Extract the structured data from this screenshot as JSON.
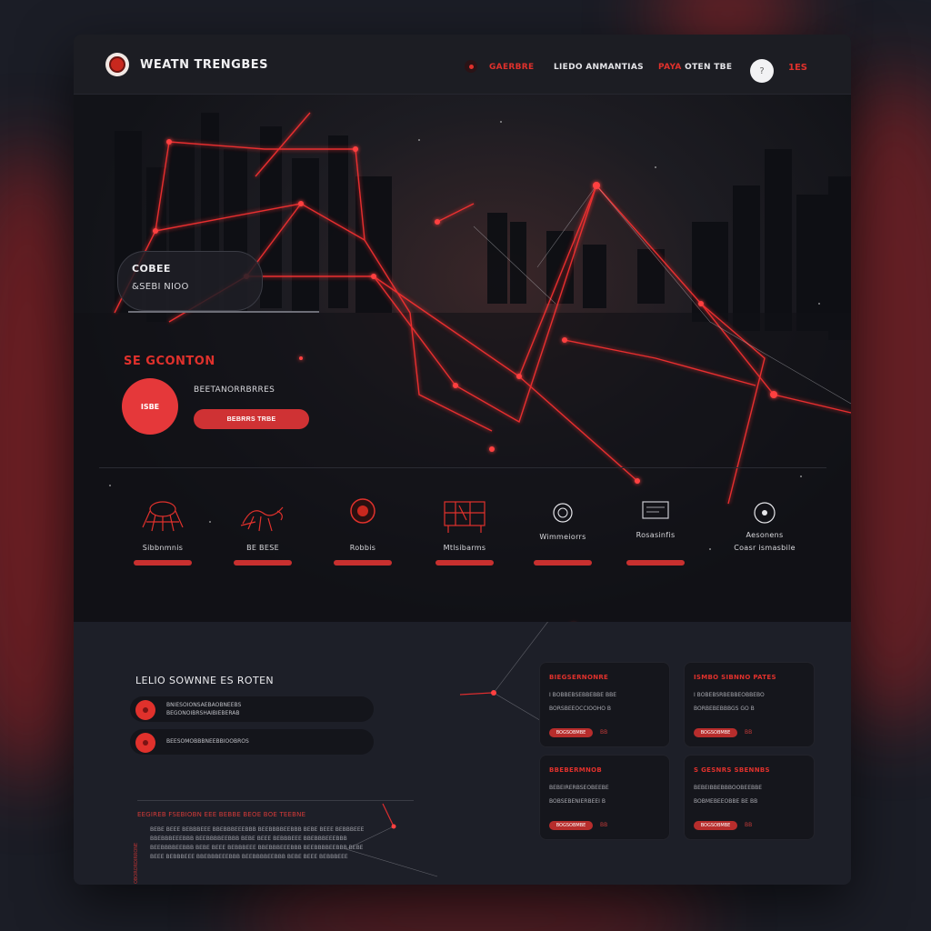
{
  "brand": {
    "name": "WEATN TRENGBES"
  },
  "nav": {
    "link1": "GAERBRE",
    "link2": "LIEDO ANMANTIAS",
    "link3_highlight": "PAYA",
    "link3_rest": "OTEN TBE",
    "count": "1ES"
  },
  "hero": {
    "pill_label": "COBEE",
    "pill_sub": "&SEBI NIOO",
    "section_title": "SE GCONTON",
    "circle_label": "ISBE",
    "caption": "BEETANORRBRRES",
    "button_label": "BEBRRS TRBE"
  },
  "features": [
    {
      "label": "Sibbnmnis"
    },
    {
      "label": "BE BESE"
    },
    {
      "label": "Robbis"
    },
    {
      "label": "Mtlsibarms"
    },
    {
      "label": "Wimmeiorrs"
    },
    {
      "label": "Rosasinfis"
    },
    {
      "label_top": "Aesonens",
      "label": "Coasr ismasbile"
    }
  ],
  "bottom": {
    "list_title": "LELIO SOWNNE ES ROTEN",
    "rows": [
      {
        "line1": "BNIESOIONSAEBAOBNEEBS",
        "line2": "BEGONOIBRSHAIBIEBERAB"
      },
      {
        "line1": "BEESOMOBBBNEEBBIOOBROS",
        "line2": ""
      }
    ],
    "para_head": "EEGIREB FSEBIOBN EEE BEBBE BEOE BOE TEEBNE",
    "para_vert": "OBORORDIRRONE",
    "para": "BEBE BEEE BEBBBEEE BBEBBBEEEBBB BEEBBBBEEBBB BEBE BEEE BEBBBEEE BBEBBBEEEBBB BEEBBBBEEBBB BEBE BEEE BEBBBEEE BBEBBBEEEBBB BEEBBBBEEBBB BEBE BEEE BEBBBEEE BBEBBBEEEBBB BEEBBBBEEBBB BEBE BEEE BEBBBEEE BBEBBBEEEBBB BEEBBBBEEBBB BEBE BEEE BEBBBEEE"
  },
  "cards": [
    {
      "title": "BIEGSERNONRE",
      "line1": "I BOBBEBSEBBEBBE BBE",
      "line2": "BORSBEEOCCIOOHO B",
      "tag": "BOGSOBMBE",
      "tag2": "BB"
    },
    {
      "title": "ISMBO SIBNNO PATES",
      "line1": "I BOBEBSRBEBBEOBBEBO",
      "line2": "BORBEBEBBBGS GO B",
      "tag": "BOGSOBMBE",
      "tag2": "BB"
    },
    {
      "title": "BBEBERMNOB",
      "line1": "BEBEIRERBSEOBEEBE",
      "line2": "BOBSEBENIERBEEI B",
      "tag": "BOGSOBMBE",
      "tag2": "BB"
    },
    {
      "title": "S GESNRS SBENNBS",
      "line1": "BEBEIBBEBBBOOBEEBBE",
      "line2": "BOBMEBEEOBBE BE BB",
      "tag": "BOGSOBMBE",
      "tag2": "BB"
    }
  ],
  "colors": {
    "accent": "#e0312c",
    "bg": "#1a1c23",
    "panel": "#15161c"
  }
}
